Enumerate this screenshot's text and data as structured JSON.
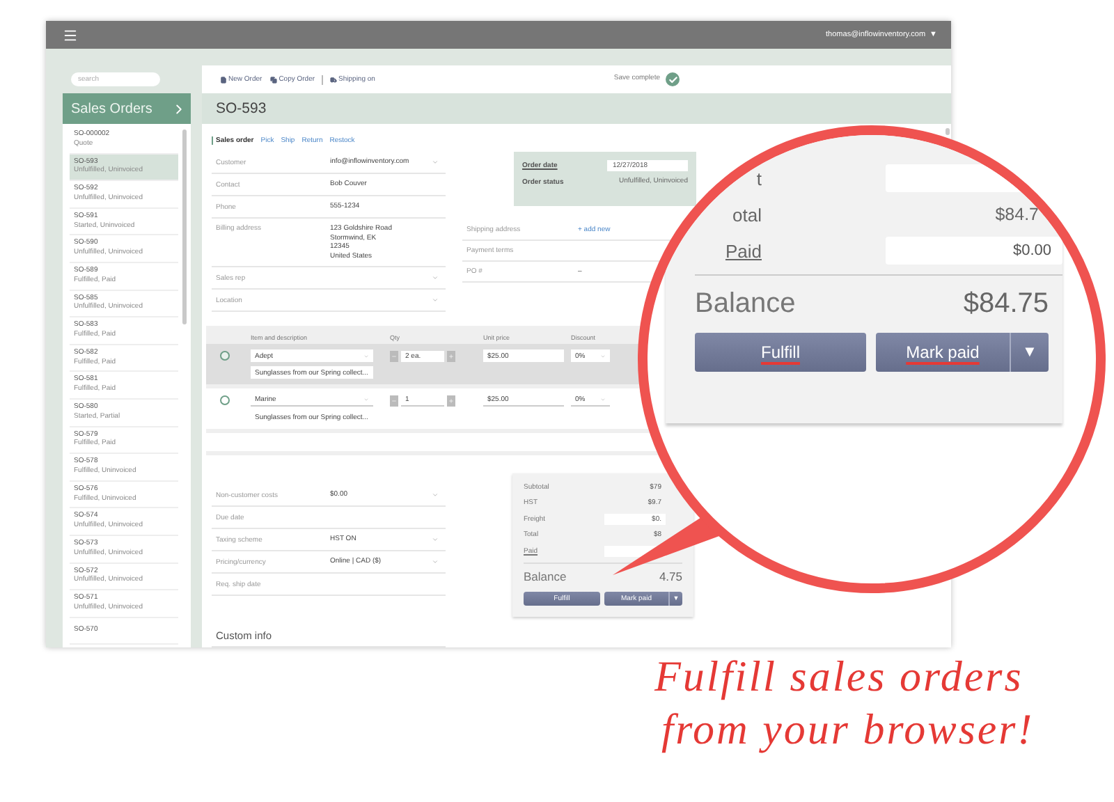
{
  "top_bar": {
    "user": "thomas@inflowinventory.com",
    "caret": "▼"
  },
  "sidebar": {
    "search": {
      "placeholder": "search"
    },
    "title": "Sales Orders",
    "orders": [
      {
        "number": "SO-000002",
        "status": "Quote",
        "selected": false
      },
      {
        "number": "SO-593",
        "status": "Unfulfilled, Uninvoiced",
        "selected": true
      },
      {
        "number": "SO-592",
        "status": "Unfulfilled, Uninvoiced",
        "selected": false
      },
      {
        "number": "SO-591",
        "status": "Started, Uninvoiced",
        "selected": false
      },
      {
        "number": "SO-590",
        "status": "Unfulfilled, Uninvoiced",
        "selected": false
      },
      {
        "number": "SO-589",
        "status": "Fulfilled, Paid",
        "selected": false
      },
      {
        "number": "SO-585",
        "status": "Unfulfilled, Uninvoiced",
        "selected": false
      },
      {
        "number": "SO-583",
        "status": "Fulfilled, Paid",
        "selected": false
      },
      {
        "number": "SO-582",
        "status": "Fulfilled, Paid",
        "selected": false
      },
      {
        "number": "SO-581",
        "status": "Fulfilled, Paid",
        "selected": false
      },
      {
        "number": "SO-580",
        "status": "Started, Partial",
        "selected": false
      },
      {
        "number": "SO-579",
        "status": "Fulfilled, Paid",
        "selected": false
      },
      {
        "number": "SO-578",
        "status": "Fulfilled, Uninvoiced",
        "selected": false
      },
      {
        "number": "SO-576",
        "status": "Fulfilled, Uninvoiced",
        "selected": false
      },
      {
        "number": "SO-574",
        "status": "Unfulfilled, Uninvoiced",
        "selected": false
      },
      {
        "number": "SO-573",
        "status": "Unfulfilled, Uninvoiced",
        "selected": false
      },
      {
        "number": "SO-572",
        "status": "Unfulfilled, Uninvoiced",
        "selected": false
      },
      {
        "number": "SO-571",
        "status": "Unfulfilled, Uninvoiced",
        "selected": false
      },
      {
        "number": "SO-570",
        "selected": false
      }
    ]
  },
  "toolbar": {
    "actions": [
      "New Order",
      "Copy Order",
      "Shipping on"
    ],
    "save_status": "Save complete"
  },
  "order": {
    "title": "SO-593",
    "tabs": [
      {
        "label": "Sales order",
        "selected": true
      },
      {
        "label": "Pick",
        "selected": false
      },
      {
        "label": "Ship",
        "selected": false
      },
      {
        "label": "Return",
        "selected": false
      },
      {
        "label": "Restock",
        "selected": false
      }
    ],
    "customer_fields": [
      {
        "label": "Customer",
        "value": [
          "info@inflowinventory.com"
        ],
        "dropdown": true
      },
      {
        "label": "Contact",
        "value": [
          "Bob Couver"
        ],
        "dropdown": false
      },
      {
        "label": "Phone",
        "value": [
          "555-1234"
        ],
        "dropdown": false
      },
      {
        "label": "Billing address",
        "value": [
          "123 Goldshire Road",
          "Stormwind, EK",
          "12345",
          "United States"
        ],
        "dropdown": false
      },
      {
        "label": "Sales rep",
        "dropdown": true
      },
      {
        "label": "Location",
        "dropdown": true
      }
    ],
    "order_info": {
      "date_label": "Order date",
      "date": "12/27/2018",
      "status_label": "Order status",
      "status": "Unfulfilled, Uninvoiced"
    },
    "shipping_fields": [
      {
        "label": "Shipping address",
        "value": "+ add new",
        "kind": "link"
      },
      {
        "label": "Payment terms",
        "kind": "text"
      },
      {
        "label": "PO #",
        "value": "–",
        "kind": "text"
      }
    ],
    "items": {
      "columns": [
        "Item and description",
        "Qty",
        "Unit price",
        "Discount"
      ],
      "rows": [
        {
          "item": "Adept",
          "quantity": "2 ea.",
          "unit_price": "$25.00",
          "discount": "0%",
          "description": "Sunglasses from our Spring collect...",
          "selected": true
        },
        {
          "item": "Marine",
          "quantity": "1",
          "unit_price": "$25.00",
          "discount": "0%",
          "description": "Sunglasses from our Spring collect...",
          "selected": false
        }
      ]
    },
    "detail_fields": [
      {
        "label": "Non-customer costs",
        "value": "$0.00",
        "dropdown": true
      },
      {
        "label": "Due date",
        "dropdown": false
      },
      {
        "label": "Taxing scheme",
        "value": "HST ON",
        "dropdown": true
      },
      {
        "label": "Pricing/currency",
        "value": "Online | CAD ($)",
        "dropdown": true
      },
      {
        "label": "Req. ship date",
        "dropdown": false
      }
    ],
    "summary": {
      "rows": [
        {
          "label": "Subtotal",
          "value": "$79",
          "kind": "amount",
          "link": false
        },
        {
          "label": "HST",
          "value": "$9.7",
          "kind": "amount",
          "link": false
        },
        {
          "label": "Freight",
          "value": "$0.",
          "kind": "input",
          "link": false
        },
        {
          "label": "Total",
          "value": "$8",
          "kind": "amount",
          "link": false
        },
        {
          "label": "Paid",
          "kind": "input",
          "link": true
        }
      ],
      "balance_label": "Balance",
      "balance": "4.75",
      "fulfill": "Fulfill",
      "mark_paid": "Mark paid",
      "more": "▼"
    },
    "custom_info": "Custom info"
  },
  "magnifier": {
    "rows": [
      {
        "label": "t",
        "kind": "input",
        "link": false
      },
      {
        "label": "otal",
        "value": "$84.7",
        "kind": "amount",
        "link": false
      },
      {
        "label": "Paid",
        "value": "$0.00",
        "kind": "input",
        "link": true
      }
    ],
    "balance_label": "Balance",
    "balance": "$84.75",
    "fulfill": "Fulfill",
    "mark_paid": "Mark paid",
    "more": "▼"
  },
  "tagline": [
    "Fulfill sales orders",
    "from your browser!"
  ]
}
